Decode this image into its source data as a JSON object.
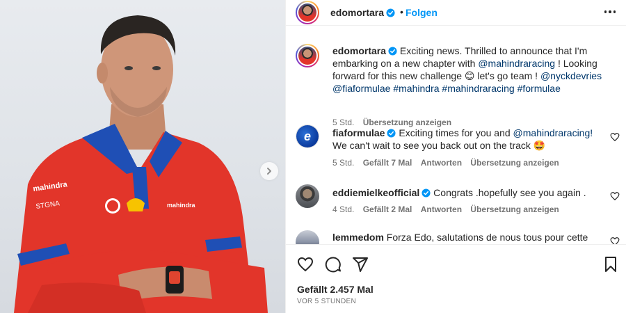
{
  "post": {
    "author": "edomortara",
    "separator": "•",
    "follow_label": "Folgen"
  },
  "caption": {
    "username": "edomortara",
    "text_before": "Exciting news. Thrilled to announce that I'm embarking on a new chapter with ",
    "mention_1": "@mahindraracing",
    "text_middle": " ! Looking forward for this new challenge 😊 let's go team ! ",
    "mention_2": "@nyckdevries",
    "mention_3": "@fiaformulae",
    "hashtag_1": "#mahindra",
    "hashtag_2": "#mahindraracing",
    "hashtag_3": "#formulae",
    "time": "5 Std.",
    "translate": "Übersetzung anzeigen"
  },
  "comments": [
    {
      "username": "fiaformulae",
      "text_before": " Exciting times for you and ",
      "mention": "@mahindraracing!",
      "text_after": " We can't wait to see you back out on the track 🤩",
      "time": "5 Std.",
      "likes": "Gefällt 7 Mal",
      "reply": "Antworten",
      "translate": "Übersetzung anzeigen"
    },
    {
      "username": "eddiemielkeofficial",
      "text": " Congrats .hopefully see you again .",
      "time": "4 Std.",
      "likes": "Gefällt 2 Mal",
      "reply": "Antworten",
      "translate": "Übersetzung anzeigen"
    },
    {
      "username": "lemmedom",
      "text": " Forza Edo, salutations de nous tous pour cette"
    }
  ],
  "footer": {
    "likes": "Gefällt 2.457 Mal",
    "ago": "VOR 5 STUNDEN"
  },
  "colors": {
    "link": "#00376b",
    "follow": "#0095f6",
    "verified": "#0095f6",
    "shirt": "#e2352a",
    "collar": "#1f4fb5"
  },
  "icons": {
    "verified": "verified-badge-icon",
    "next": "chevron-right-icon",
    "more": "more-options-icon",
    "like": "heart-icon",
    "comment": "comment-icon",
    "share": "share-icon",
    "save": "bookmark-icon"
  }
}
